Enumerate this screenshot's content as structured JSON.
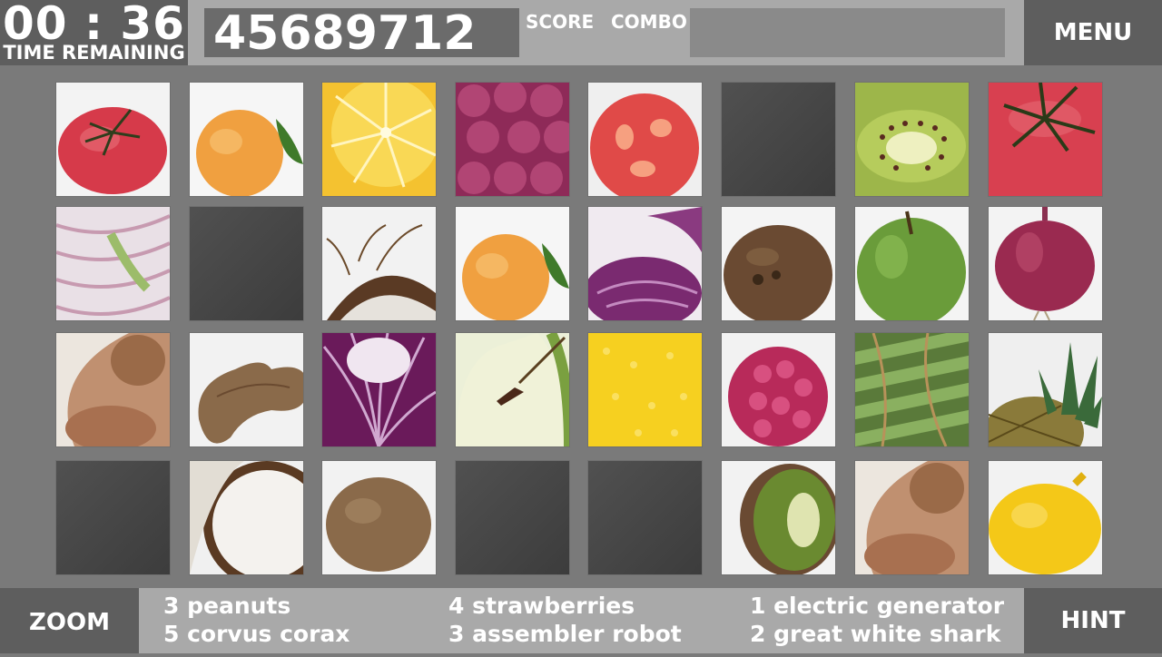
{
  "hud": {
    "timer": "00 : 36",
    "timer_label": "TIME REMAINING",
    "score": "45689712",
    "score_label": "SCORE",
    "combo_label": "COMBO",
    "menu_label": "MENU"
  },
  "board": {
    "tiles": [
      {
        "item": "tomato"
      },
      {
        "item": "apricot"
      },
      {
        "item": "lemon-half"
      },
      {
        "item": "raspberry-closeup"
      },
      {
        "item": "tomato-slice"
      },
      {
        "item": "empty"
      },
      {
        "item": "kiwi-slice"
      },
      {
        "item": "tomato-top"
      },
      {
        "item": "onion-slice"
      },
      {
        "item": "empty"
      },
      {
        "item": "coconut-roots"
      },
      {
        "item": "apricot"
      },
      {
        "item": "red-cabbage"
      },
      {
        "item": "coconut"
      },
      {
        "item": "green-apple"
      },
      {
        "item": "red-onion"
      },
      {
        "item": "peanut-open"
      },
      {
        "item": "peanut"
      },
      {
        "item": "red-cabbage-slice"
      },
      {
        "item": "apple-slice"
      },
      {
        "item": "lemon-closeup"
      },
      {
        "item": "raspberry"
      },
      {
        "item": "asparagus"
      },
      {
        "item": "pineapple"
      },
      {
        "item": "empty"
      },
      {
        "item": "coconut-half"
      },
      {
        "item": "kiwi"
      },
      {
        "item": "empty"
      },
      {
        "item": "empty"
      },
      {
        "item": "kiwi-half"
      },
      {
        "item": "peanut-open"
      },
      {
        "item": "lemon"
      }
    ]
  },
  "goals": {
    "col1": [
      "3 peanuts",
      "5 corvus corax"
    ],
    "col2": [
      "4 strawberries",
      "3 assembler robot"
    ],
    "col3": [
      "1 electric generator",
      "2 great white shark"
    ]
  },
  "buttons": {
    "zoom_label": "ZOOM",
    "hint_label": "HINT"
  }
}
